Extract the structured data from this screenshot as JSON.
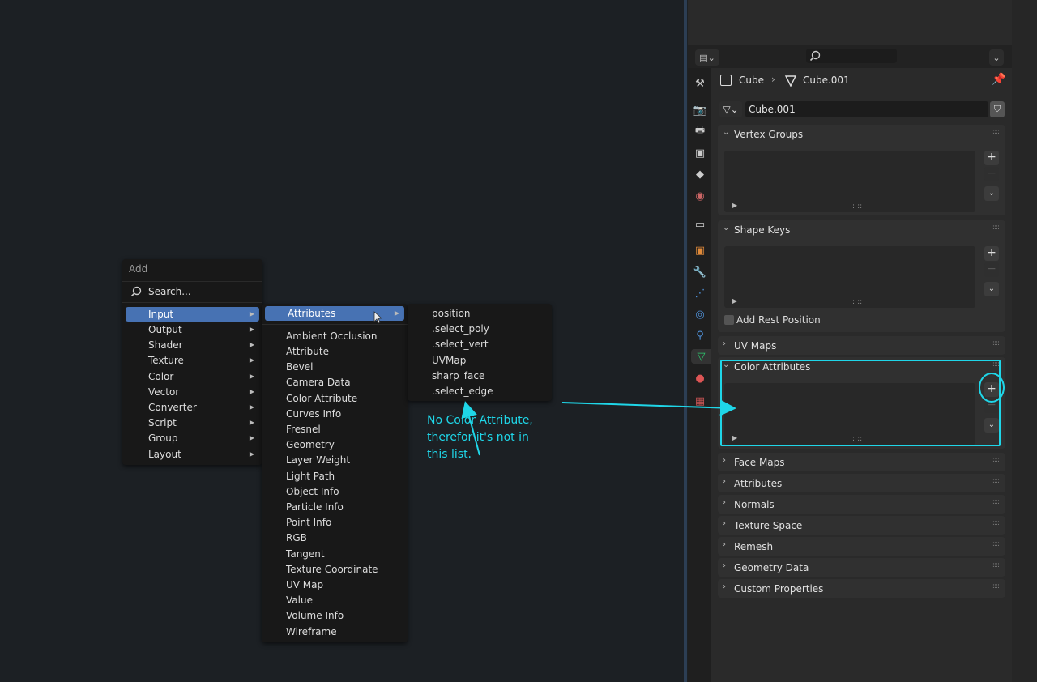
{
  "add_menu": {
    "title": "Add",
    "search_label": "Search...",
    "items": [
      {
        "label": "Input",
        "selected": true
      },
      {
        "label": "Output"
      },
      {
        "label": "Shader"
      },
      {
        "label": "Texture"
      },
      {
        "label": "Color"
      },
      {
        "label": "Vector"
      },
      {
        "label": "Converter"
      },
      {
        "label": "Script"
      },
      {
        "label": "Group"
      },
      {
        "label": "Layout"
      }
    ]
  },
  "input_menu": {
    "selected": "Attributes",
    "items": [
      "Ambient Occlusion",
      "Attribute",
      "Bevel",
      "Camera Data",
      "Color Attribute",
      "Curves Info",
      "Fresnel",
      "Geometry",
      "Layer Weight",
      "Light Path",
      "Object Info",
      "Particle Info",
      "Point Info",
      "RGB",
      "Tangent",
      "Texture Coordinate",
      "UV Map",
      "Value",
      "Volume Info",
      "Wireframe"
    ]
  },
  "attributes_menu": {
    "items": [
      "position",
      ".select_poly",
      ".select_vert",
      "UVMap",
      "sharp_face",
      ".select_edge"
    ]
  },
  "annotation": {
    "line1": "No Color Attribute,",
    "line2": "therefor it's not in",
    "line3": "this list.",
    "color": "#1fd6e8"
  },
  "properties": {
    "breadcrumb_object": "Cube",
    "breadcrumb_mesh": "Cube.001",
    "mesh_name": "Cube.001",
    "panels": {
      "vertex_groups": "Vertex Groups",
      "shape_keys": "Shape Keys",
      "add_rest_position": "Add Rest Position",
      "uv_maps": "UV Maps",
      "color_attributes": "Color Attributes"
    },
    "collapsed_panels": [
      "Face Maps",
      "Attributes",
      "Normals",
      "Texture Space",
      "Remesh",
      "Geometry Data",
      "Custom Properties"
    ]
  },
  "icons": {
    "search": "search-icon",
    "pin": "pin-icon",
    "mesh": "mesh-data-icon",
    "object": "object-icon",
    "fake_user": "shield-icon"
  },
  "colors": {
    "selection": "#4772b3",
    "annotation": "#1fd6e8",
    "active_tab": "#2ecc71"
  }
}
